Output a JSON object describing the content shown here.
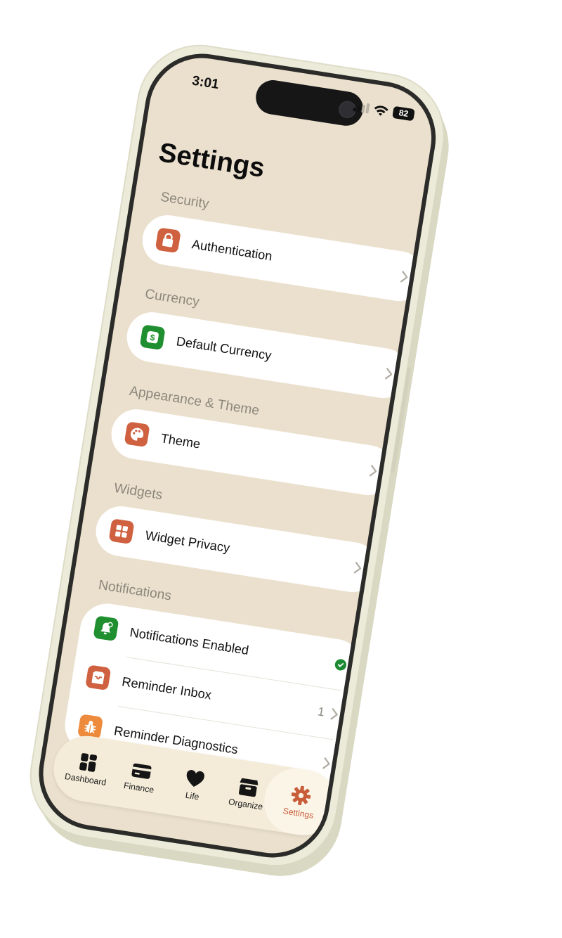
{
  "status": {
    "time": "3:01",
    "battery": "82"
  },
  "page": {
    "title": "Settings"
  },
  "sections": [
    {
      "label": "Security",
      "items": [
        {
          "label": "Authentication",
          "icon": "lock-icon",
          "color": "#cf6140"
        }
      ]
    },
    {
      "label": "Currency",
      "items": [
        {
          "label": "Default Currency",
          "icon": "dollar-icon",
          "color": "#1f8f2f"
        }
      ]
    },
    {
      "label": "Appearance & Theme",
      "items": [
        {
          "label": "Theme",
          "icon": "palette-icon",
          "color": "#cf6140"
        }
      ]
    },
    {
      "label": "Widgets",
      "items": [
        {
          "label": "Widget Privacy",
          "icon": "grid-icon",
          "color": "#cf6140"
        }
      ]
    },
    {
      "label": "Notifications",
      "items": [
        {
          "label": "Notifications Enabled",
          "icon": "bell-icon",
          "color": "#1f8f2f"
        },
        {
          "label": "Reminder Inbox",
          "icon": "inbox-icon",
          "color": "#cf6140",
          "badge": "1"
        },
        {
          "label": "Reminder Diagnostics",
          "icon": "bug-icon",
          "color": "#ee8a3c"
        }
      ]
    }
  ],
  "tabs": [
    {
      "label": "Dashboard",
      "icon": "dashboard-icon"
    },
    {
      "label": "Finance",
      "icon": "card-icon"
    },
    {
      "label": "Life",
      "icon": "heart-icon"
    },
    {
      "label": "Organize",
      "icon": "box-icon"
    },
    {
      "label": "Settings",
      "icon": "gear-icon",
      "active": true
    }
  ],
  "colors": {
    "accent": "#c85d3a",
    "background": "#ebe0cd",
    "success": "#1c8a32"
  }
}
